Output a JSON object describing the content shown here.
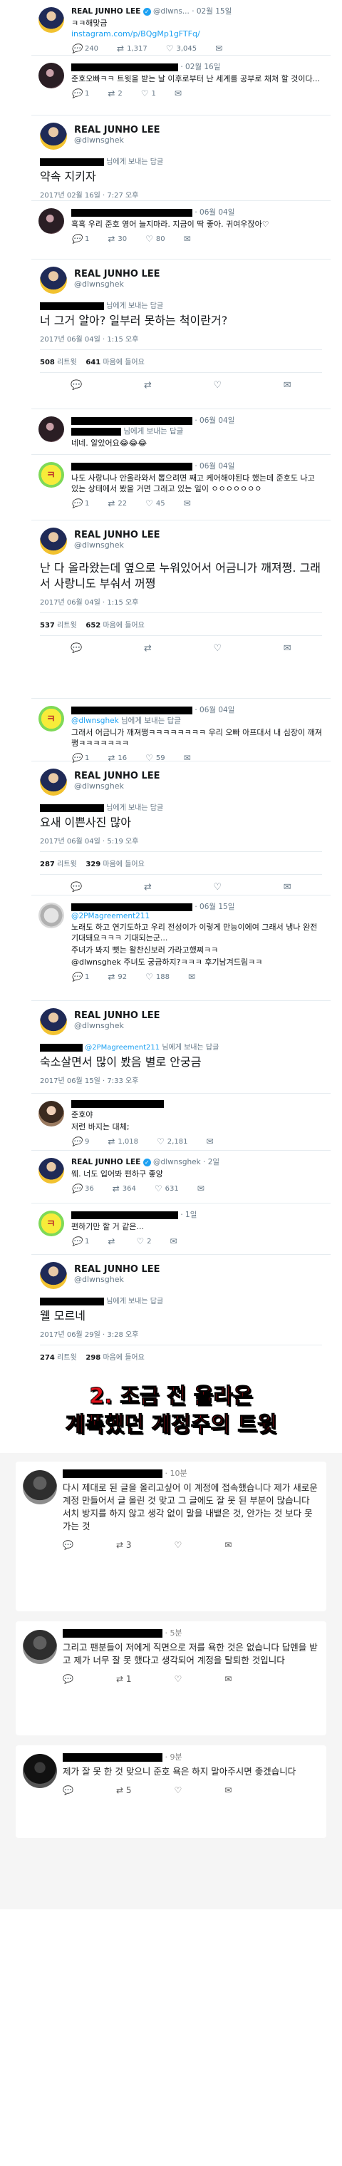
{
  "t1": {
    "name": "REAL JUNHO LEE",
    "handle": "@dlwns...",
    "date": "02월 15일",
    "text": "ㅋㅋ해맞금 ",
    "link": "instagram.com/p/BQgMp1gFTFq/",
    "reply": "",
    "rt": "1,317",
    "like": "3,045",
    "num240": "240"
  },
  "t2": {
    "date": "02월 16일",
    "text": "준호오빠ㅋㅋ 트윗을 받는 날 이후로부터 난 세계를 공부로 채쳐 할 것이다...",
    "reply": "1",
    "rt": "2",
    "like": "1"
  },
  "m1": {
    "name": "REAL JUNHO LEE",
    "handle": "@dlwnsghek",
    "replyto": "님에게 보내는 답글",
    "text": "약속 지키자",
    "date": "2017년 02월 16일 · 7:27 오후"
  },
  "t3": {
    "date": "06월 04일",
    "text": "흑흑 우리 준호 영어 늘지마라. 지금이 딱 좋아. 귀여우잖아♡",
    "reply": "1",
    "rt": "30",
    "like": "80"
  },
  "m2": {
    "name": "REAL JUNHO LEE",
    "handle": "@dlwnsghek",
    "replyto": "님에게 보내는 답글",
    "text": "너 그거 알아? 일부러 못하는 척이란거?",
    "date": "2017년 06월 04일 · 1:15 오후",
    "rt_count": "508",
    "rt_label": "리트윗",
    "like_count": "641",
    "like_label": "마음에 들어요"
  },
  "t4": {
    "replyto": "님에게 보내는 답글",
    "date": "06월 04일",
    "text": "네네. 알았어요😂😂😂",
    "reply": "",
    "rt": "",
    "like": ""
  },
  "t5": {
    "date": "06월 04일",
    "text": "나도 사랑니나 안올라와서 뽑으려면 째고 케어해야된다 했는데 준호도 나고 있는 상태에서 봤을 거면 그래고 있는 일이 ㅇㅇㅇㅇㅇㅇㅇ",
    "reply": "1",
    "rt": "22",
    "like": "45"
  },
  "m3": {
    "name": "REAL JUNHO LEE",
    "handle": "@dlwnsghek",
    "text": "난 다 올라왔는데 옆으로 누워있어서 어금니가 깨져쪙. 그래서 사랑니도 부숴서 꺼쪙",
    "date": "2017년 06월 04일 · 1:15 오후",
    "rt_count": "537",
    "rt_label": "리트윗",
    "like_count": "652",
    "like_label": "마음에 들어요"
  },
  "t6": {
    "mention": "@dlwnsghek",
    "replyto": "님에게 보내는 답글",
    "date": "06월 04일",
    "text": "그래서 어금니가 깨져쪙ㅋㅋㅋㅋㅋㅋㅋㅋ 우리 오빠 아프대서 내 심장이 깨져쪙ㅋㅋㅋㅋㅋㅋㅋ",
    "reply": "1",
    "rt": "16",
    "like": "59"
  },
  "m4": {
    "name": "REAL JUNHO LEE",
    "handle": "@dlwnsghek",
    "replyto": "님에게 보내는 답글",
    "text": "요새 이쁜사진 많아",
    "date": "2017년 06월 04일 · 5:19 오후",
    "rt_count": "287",
    "rt_label": "리트윗",
    "like_count": "329",
    "like_label": "마음에 들어요"
  },
  "t7": {
    "mention": "@2PMagreement211",
    "date": "06월 15일",
    "text": "노래도 하고 연기도하고 우리 전성이가 이렇게 만능이에여 그래서 냉나 완전 기대돼요ㅋㅋㅋ 기대되는군...",
    "text2": "주녀가 봐지 뻣는 왈찬신보러 가라고했쪄ㅋㅋ",
    "text3": "@dlwnsghek 주녀도 궁금하지?ㅋㅋㅋ 후기남겨드림ㅋㅋ",
    "reply": "1",
    "rt": "92",
    "like": "188"
  },
  "m5": {
    "name": "REAL JUNHO LEE",
    "handle": "@dlwnsghek",
    "mention": "@2PMagreement211",
    "replyto": "님에게 보내는 답글",
    "text": "숙소살면서 많이 봤음 별로 안궁금",
    "date": "2017년 06월 15일 · 7:33 오후"
  },
  "t8": {
    "text1": "준호야",
    "text2": "저런 바지는 대체;",
    "reply": "9",
    "rt": "1,018",
    "like": "2,181"
  },
  "t9": {
    "name": "REAL JUNHO LEE",
    "handle": "@dlwnsghek · 2일",
    "text": "웨. 너도 입어봐 편하구 좋앙",
    "reply": "36",
    "rt": "364",
    "like": "631"
  },
  "t10": {
    "date": "1일",
    "text": "편하기만 할 거 같은...",
    "reply": "1",
    "rt": "",
    "like": "2"
  },
  "m6": {
    "name": "REAL JUNHO LEE",
    "handle": "@dlwnsghek",
    "replyto": "님에게 보내는 답글",
    "text": "웰 모르네",
    "date": "2017년 06월 29일 · 3:28 오후",
    "rt_count": "274",
    "rt_label": "리트윗",
    "like_count": "298",
    "like_label": "마음에 들어요"
  },
  "banner": {
    "line1": "2. 조금 전 올라온",
    "line2": "계폭했던 계정주의 트윗"
  },
  "fb1": {
    "time": "10분",
    "text": "다시 제대로 된 글을 올리고싶어 이 계정에 접속했습니다 제가 새로운 계정 만들어서 글 올린 것 맞고 그 글에도 잘 못 된 부분이 많습니다 서치 방지를 하지 않고 생각 없이 말을 내뱉은 것, 안가는 것 보다 못 가는 것",
    "comment": "3"
  },
  "fb2": {
    "time": "5분",
    "text": "그리고 팬분들이 저에게 직면으로 저를 욕한 것은 없습니다 답멘을 받고 제가 너무 잘 못 했다고 생각되어 계정을 탈퇴한 것입니다",
    "comment": "1"
  },
  "fb3": {
    "time": "9분",
    "text": "제가 잘 못 한 것 맞으니 준호 욕은 하지 말아주시면 좋겠습니다",
    "comment": "5"
  }
}
